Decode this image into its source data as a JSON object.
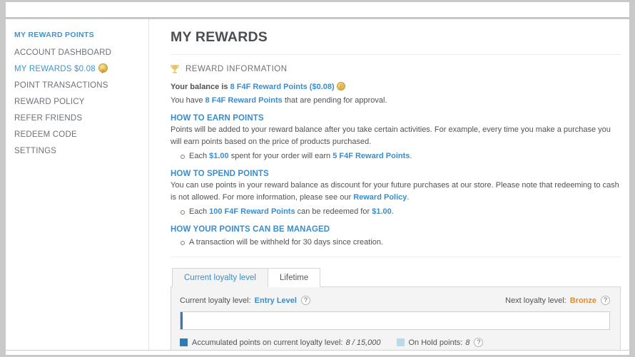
{
  "sidebar": {
    "items": [
      {
        "label": "MY REWARD POINTS",
        "style": "head"
      },
      {
        "label": "ACCOUNT DASHBOARD",
        "style": "normal"
      },
      {
        "label": "MY REWARDS $0.08",
        "style": "current",
        "icon": "coin-icon"
      },
      {
        "label": "POINT TRANSACTIONS",
        "style": "normal"
      },
      {
        "label": "REWARD POLICY",
        "style": "normal"
      },
      {
        "label": "REFER FRIENDS",
        "style": "normal"
      },
      {
        "label": "REDEEM CODE",
        "style": "normal"
      },
      {
        "label": "SETTINGS",
        "style": "normal"
      }
    ]
  },
  "main": {
    "title": "MY REWARDS",
    "reward_information": {
      "icon": "trophy-icon",
      "heading": "REWARD INFORMATION",
      "balance_prefix": "Your balance is",
      "balance_value": "8 F4F Reward Points ($0.08)",
      "pending_prefix": "You have",
      "pending_value": "8 F4F Reward Points",
      "pending_suffix": "that are pending for approval."
    },
    "how_to_earn": {
      "heading": "HOW TO EARN POINTS",
      "body": "Points will be added to your reward balance after you take certain activities. For example, every time you make a purchase you will earn points based on the price of products purchased.",
      "bullet_prefix": "Each",
      "bullet_amount": "$1.00",
      "bullet_middle": "spent for your order will earn",
      "bullet_points": "5 F4F Reward Points",
      "bullet_suffix": "."
    },
    "how_to_spend": {
      "heading": "HOW TO SPEND POINTS",
      "body_part1": "You can use points in your reward balance as discount for your future purchases at our store. Please note that redeeming to cash is not allowed.  For more information, please see our",
      "policy_link": "Reward Policy",
      "body_part2": ".",
      "bullet_prefix": "Each",
      "bullet_points": "100 F4F Reward Points",
      "bullet_middle": "can be redeemed for",
      "bullet_amount": "$1.00",
      "bullet_suffix": "."
    },
    "how_managed": {
      "heading": "HOW YOUR POINTS CAN BE MANAGED",
      "bullet": "A transaction will be withheld for 30 days since creation."
    },
    "tabs": [
      {
        "label": "Current loyalty level",
        "selected": true
      },
      {
        "label": "Lifetime",
        "selected": false
      }
    ],
    "loyalty": {
      "current_label": "Current loyalty level:",
      "current_value": "Entry Level",
      "current_help": "?",
      "next_label": "Next loyalty level:",
      "next_value": "Bronze",
      "next_help": "?",
      "progress_percent": 0.05,
      "legend": [
        {
          "swatch": "accum",
          "label": "Accumulated points on current loyalty level:",
          "value": "8 / 15,000",
          "help": null
        },
        {
          "swatch": "hold",
          "label": "On Hold points:",
          "value": "8",
          "help": "?"
        }
      ]
    }
  },
  "colors": {
    "link_blue": "#3a8dcc",
    "bronze_orange": "#e08b32",
    "accum_blue": "#2e7bb5",
    "hold_blue": "#bcd9ea",
    "gold": "#e3bc57"
  }
}
